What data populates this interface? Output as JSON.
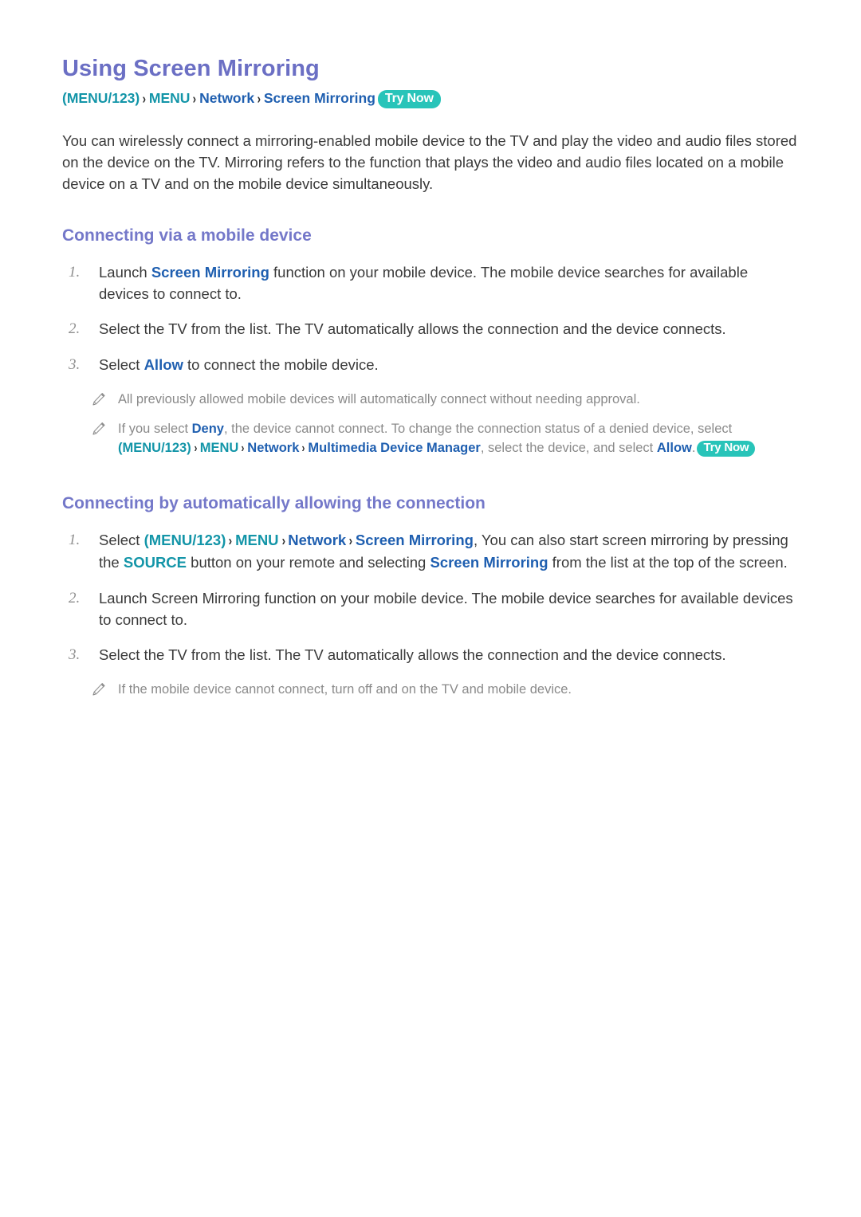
{
  "page": {
    "title": "Using Screen Mirroring",
    "breadcrumb": {
      "open_paren": "(",
      "menu123": "MENU/123",
      "close_paren": ")",
      "chevron": "›",
      "menu": "MENU",
      "network": "Network",
      "screen_mirroring": "Screen Mirroring",
      "try_now": "Try Now"
    },
    "intro_paragraph": "You can wirelessly connect a mirroring-enabled mobile device to the TV and play the video and audio files stored on the device on the TV. Mirroring refers to the function that plays the video and audio files located on a mobile device on a TV and on the mobile device simultaneously."
  },
  "section1": {
    "heading": "Connecting via a mobile device",
    "steps": [
      {
        "num": "1.",
        "pre": "Launch ",
        "link": "Screen Mirroring",
        "post": " function on your mobile device. The mobile device searches for available devices to connect to."
      },
      {
        "num": "2.",
        "pre": "Select the TV from the list. The TV automatically allows the connection and the device connects.",
        "link": "",
        "post": ""
      },
      {
        "num": "3.",
        "pre": "Select ",
        "link": "Allow",
        "post": " to connect the mobile device."
      }
    ],
    "notes": [
      {
        "icon": "pencil-icon",
        "text": "All previously allowed mobile devices will automatically connect without needing approval."
      },
      {
        "icon": "pencil-icon",
        "text_part1": "If you select ",
        "deny": "Deny",
        "text_part2": ", the device cannot connect. To change the connection status of a denied device, select ",
        "open_paren": "(",
        "menu123": "MENU/123",
        "close_paren": ")",
        "chevron": "›",
        "menu": "MENU",
        "network": "Network",
        "multimedia": "Multimedia Device Manager",
        "text_part3": ", select the device, and select ",
        "allow": "Allow",
        "text_part4": ".",
        "try_now": "Try Now"
      }
    ]
  },
  "section2": {
    "heading": "Connecting by automatically allowing the connection",
    "steps": [
      {
        "num": "1.",
        "pre": "Select ",
        "open_paren": "(",
        "menu123": "MENU/123",
        "close_paren": ")",
        "chevron": "›",
        "menu": "MENU",
        "network": "Network",
        "screen_mirroring": "Screen Mirroring",
        "mid1": ", You can also start screen mirroring by pressing the ",
        "source": "SOURCE",
        "mid2": " button on your remote and selecting ",
        "screen_mirroring2": "Screen Mirroring",
        "post": " from the list at the top of the screen."
      },
      {
        "num": "2.",
        "text": "Launch Screen Mirroring function on your mobile device. The mobile device searches for available devices to connect to."
      },
      {
        "num": "3.",
        "text": "Select the TV from the list. The TV automatically allows the connection and the device connects."
      }
    ],
    "notes": [
      {
        "icon": "pencil-icon",
        "text": "If the mobile device cannot connect, turn off and on the TV and mobile device."
      }
    ]
  },
  "colors": {
    "title": "#6b6fc4",
    "heading": "#7478c9",
    "teal": "#1395a8",
    "blue": "#1f5fb0",
    "badge": "#28c4b9",
    "body": "#3a3a3a",
    "note": "#8a8a8a"
  }
}
